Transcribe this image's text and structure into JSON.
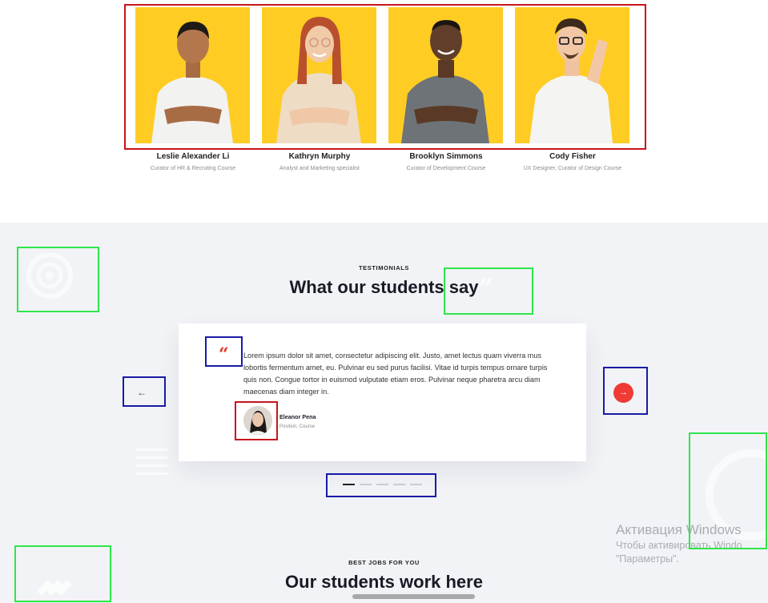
{
  "team": {
    "members": [
      {
        "name": "Leslie Alexander Li",
        "role": "Curator of HR & Recruting Course"
      },
      {
        "name": "Kathryn Murphy",
        "role": "Analyst and Marketing specialist"
      },
      {
        "name": "Brooklyn Simmons",
        "role": "Curator of Development Course"
      },
      {
        "name": "Cody Fisher",
        "role": "UX Designer, Curator of Design Course"
      }
    ]
  },
  "testimonials": {
    "eyebrow": "TESTIMONIALS",
    "title": "What our students say",
    "quote_icon": "quote-icon",
    "quote": "Lorem ipsum dolor sit amet, consectetur adipiscing elit. Justo, amet lectus quam viverra mus lobortis fermentum amet, eu. Pulvinar eu sed purus facilisi. Vitae id turpis tempus ornare turpis quis non. Congue tortor in euismod vulputate etiam eros. Pulvinar neque pharetra arcu diam maecenas diam integer in.",
    "author_name": "Eleanor Pena",
    "author_position": "Position, Course",
    "prev_label": "←",
    "next_label": "→",
    "slide_count": 5,
    "active_slide": 1
  },
  "jobs": {
    "eyebrow": "BEST JOBS FOR YOU",
    "title": "Our students work here"
  },
  "watermark": {
    "title": "Активация Windows",
    "line1": "Чтобы активировать Windo",
    "line2": "\"Параметры\"."
  },
  "colors": {
    "photo_bg": "#ffcc24",
    "accent": "#ef3b36",
    "section_bg": "#f1f3f6"
  }
}
